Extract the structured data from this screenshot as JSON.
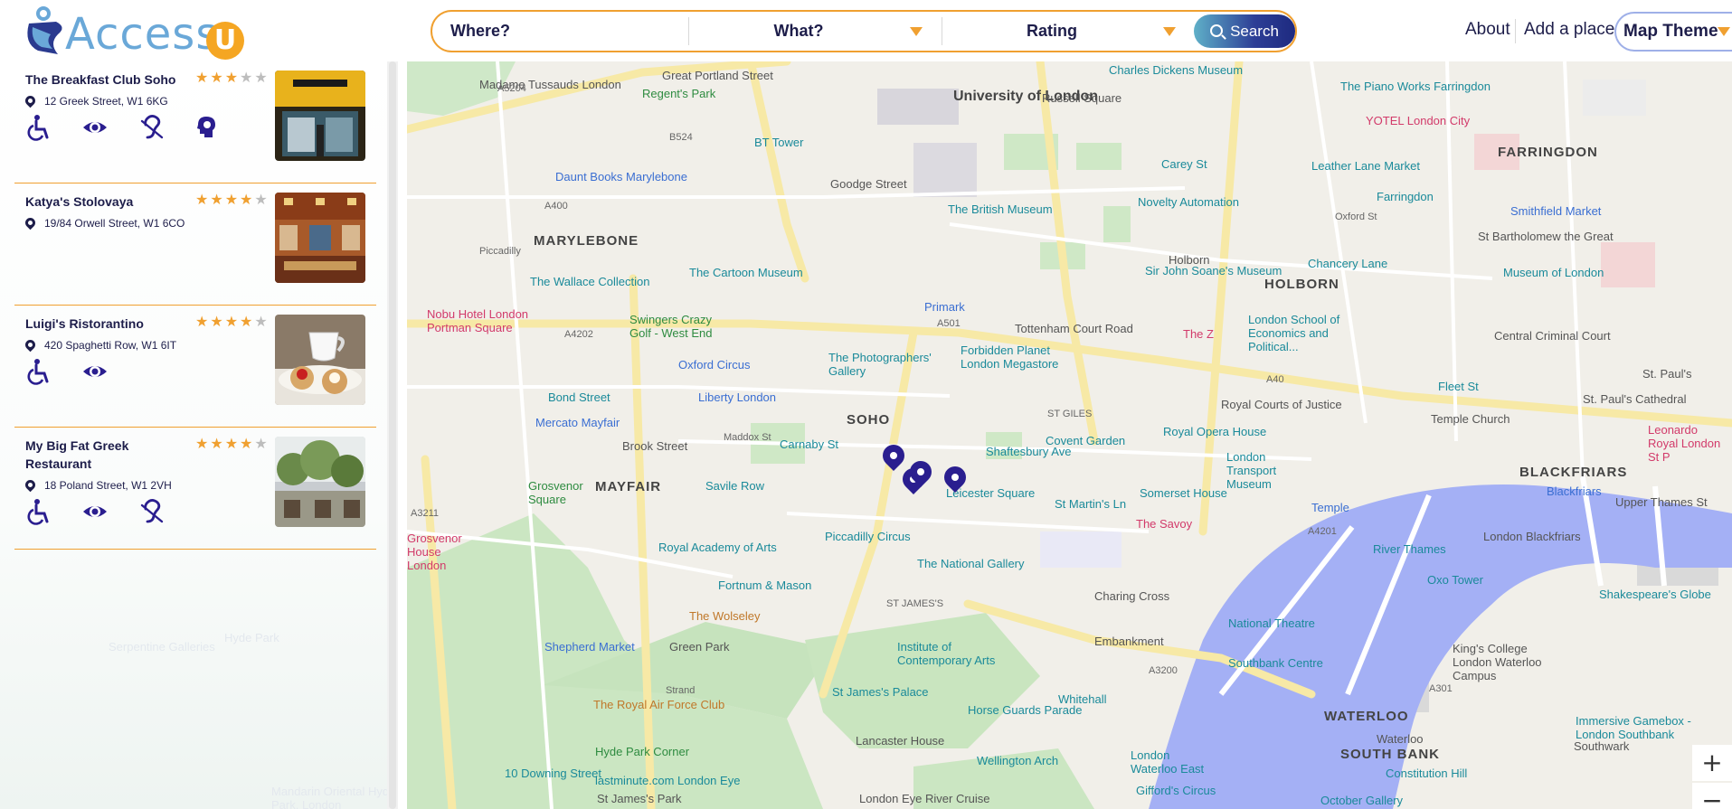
{
  "brand": {
    "name": "Access",
    "letter": "U"
  },
  "search": {
    "where_placeholder": "Where?",
    "what_label": "What?",
    "rating_label": "Rating",
    "button_label": "Search"
  },
  "nav": {
    "about": "About",
    "add_place": "Add a place",
    "map_theme": "Map Theme"
  },
  "colors": {
    "accent": "#f0a030",
    "navy": "#1d1d4a",
    "pin": "#2a1e8f",
    "water": "#a4b0f5"
  },
  "places": [
    {
      "name": "The Breakfast Club Soho",
      "rating": 3,
      "address": "12 Greek Street, W1 6KG",
      "features": [
        "wheelchair-icon",
        "eye-icon",
        "hearing-icon",
        "cognitive-icon"
      ]
    },
    {
      "name": "Katya's Stolovaya",
      "rating": 4,
      "address": "19/84 Orwell Street, W1 6CO",
      "features": []
    },
    {
      "name": "Luigi's Ristorantino",
      "rating": 4,
      "address": "420 Spaghetti Row, W1 6IT",
      "features": [
        "wheelchair-icon",
        "eye-icon"
      ]
    },
    {
      "name": "My Big Fat Greek Restaurant",
      "rating": 4,
      "address": "18 Poland Street, W1 2VH",
      "features": [
        "wheelchair-icon",
        "eye-icon",
        "hearing-icon"
      ]
    }
  ],
  "sidebar_ghost": [
    "Hyde Park",
    "Serpentine Galleries",
    "Mandarin Oriental Hyde Park, London"
  ],
  "map": {
    "districts": [
      "MARYLEBONE",
      "SOHO",
      "MAYFAIR",
      "HOLBORN",
      "FARRINGDON",
      "BLACKFRIARS",
      "WATERLOO",
      "SOUTH BANK",
      "ST GILES",
      "ST JAMES'S"
    ],
    "labels": [
      "Madame Tussauds London",
      "Regent's Park",
      "Great Portland Street",
      "University of London",
      "Russell Square",
      "Charles Dickens Museum",
      "The Piano Works Farringdon",
      "YOTEL London City",
      "BT Tower",
      "Daunt Books Marylebone",
      "Goodge Street",
      "The British Museum",
      "Novelty Automation",
      "Leather Lane Market",
      "Farringdon",
      "Smithfield Market",
      "St Bartholomew the Great",
      "The Wallace Collection",
      "The Cartoon Museum",
      "Primark",
      "Sir John Soane's Museum",
      "Holborn",
      "Chancery Lane",
      "Museum of London",
      "Nobu Hotel London Portman Square",
      "Swingers Crazy Golf - West End",
      "Tottenham Court Road",
      "Forbidden Planet London Megastore",
      "The Z",
      "London School of Economics and Political...",
      "Central Criminal Court",
      "St. Paul's",
      "Oxford Circus",
      "The Photographers' Gallery",
      "Bond Street",
      "Liberty London",
      "Royal Courts of Justice",
      "Fleet St",
      "St. Paul's Cathedral",
      "Mercato Mayfair",
      "Royal Opera House",
      "Temple Church",
      "Leonardo Royal London St P",
      "Brook Street",
      "Maddox St",
      "Carnaby St",
      "Shaftesbury Ave",
      "Covent Garden",
      "London Transport Museum",
      "Grosvenor Square",
      "Savile Row",
      "Leicester Square",
      "Somerset House",
      "St Martin's Ln",
      "Temple",
      "The Savoy",
      "Blackfriars",
      "Upper Thames St",
      "London Blackfriars",
      "Grosvenor House London",
      "Royal Academy of Arts",
      "Piccadilly Circus",
      "The National Gallery",
      "River Thames",
      "Oxo Tower",
      "Shakespeare's Globe",
      "Fortnum & Mason",
      "Charing Cross",
      "The Wolseley",
      "National Theatre",
      "Shepherd Market",
      "Green Park",
      "Institute of Contemporary Arts",
      "Embankment",
      "King's College London Waterloo Campus",
      "Southbank Centre",
      "Whitehall",
      "The Royal Air Force Club",
      "St James's Palace",
      "Horse Guards Parade",
      "Lancaster House",
      "Immersive Gamebox - London Southbank",
      "Southwark",
      "Hyde Park Corner",
      "Wellington Arch",
      "10 Downing Street",
      "lastminute.com London Eye",
      "London Waterloo East",
      "Waterloo",
      "Constitution Hill",
      "St James's Park",
      "London Eye River Cruise",
      "Gifford's Circus",
      "October Gallery",
      "Carey St",
      "A40",
      "A501",
      "A5204",
      "A4202",
      "A3211",
      "A3200",
      "A301",
      "A4201",
      "B524",
      "A400",
      "Oxford St",
      "Piccadilly",
      "Strand"
    ]
  },
  "zoom": {
    "in": "+",
    "out": "−"
  }
}
